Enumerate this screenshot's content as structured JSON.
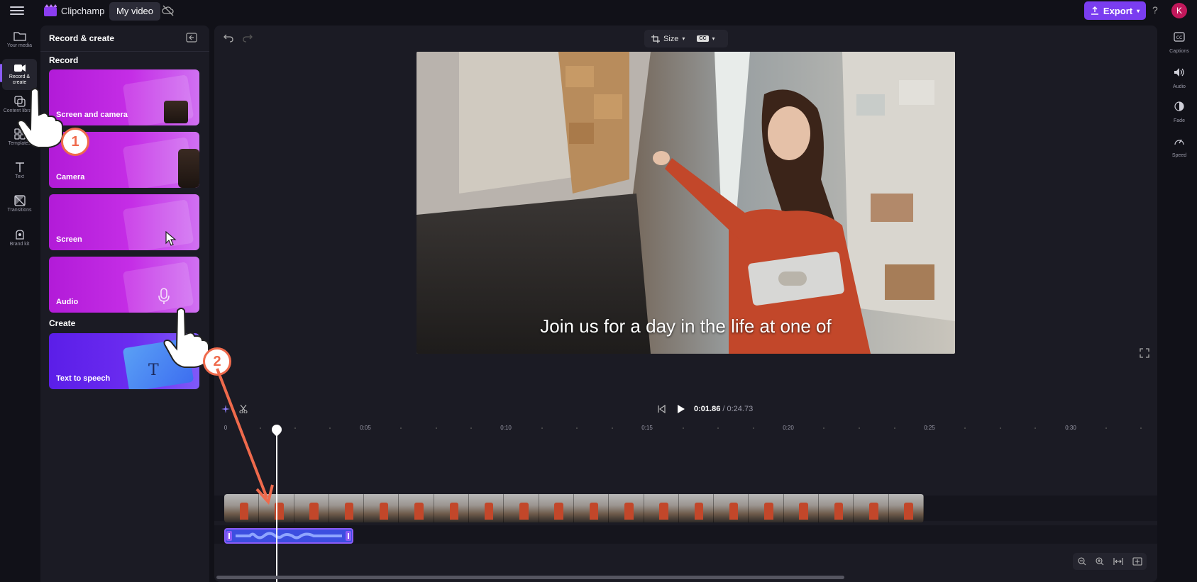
{
  "topbar": {
    "app_name": "Clipchamp",
    "project_name": "My video",
    "export_label": "Export",
    "help_label": "?",
    "avatar_initial": "K"
  },
  "left_nav": [
    {
      "label": "Your media",
      "icon": "folder-icon"
    },
    {
      "label": "Record & create",
      "icon": "video-camera-icon",
      "active": true
    },
    {
      "label": "Content library",
      "icon": "content-library-icon"
    },
    {
      "label": "Templates",
      "icon": "templates-icon"
    },
    {
      "label": "Text",
      "icon": "text-icon"
    },
    {
      "label": "Transitions",
      "icon": "transitions-icon"
    },
    {
      "label": "Brand kit",
      "icon": "brand-kit-icon"
    }
  ],
  "panel": {
    "title": "Record & create",
    "record_section": "Record",
    "create_section": "Create",
    "cards": [
      "Screen and camera",
      "Camera",
      "Screen",
      "Audio"
    ],
    "create_cards": [
      "Text to speech"
    ]
  },
  "toolbar": {
    "size_label": "Size",
    "cc_label": "CC"
  },
  "preview": {
    "caption": "Join us for a day in the life at one of"
  },
  "right_panel": [
    {
      "label": "Captions",
      "icon": "captions-icon"
    },
    {
      "label": "Audio",
      "icon": "speaker-icon"
    },
    {
      "label": "Fade",
      "icon": "fade-icon"
    },
    {
      "label": "Speed",
      "icon": "speed-icon"
    }
  ],
  "playback": {
    "current_time": "0:01.86",
    "total_time": "/ 0:24.73"
  },
  "timeline": {
    "ruler_labels": [
      "0",
      "0:05",
      "0:10",
      "0:15",
      "0:20",
      "0:25",
      "0:30"
    ]
  },
  "annotations": {
    "step1": "1",
    "step2": "2"
  },
  "colors": {
    "accent": "#7a3df0",
    "card_gradient": "#c52ee6",
    "step_marker": "#ef6a4c",
    "audio_clip": "#3c4ee0"
  }
}
